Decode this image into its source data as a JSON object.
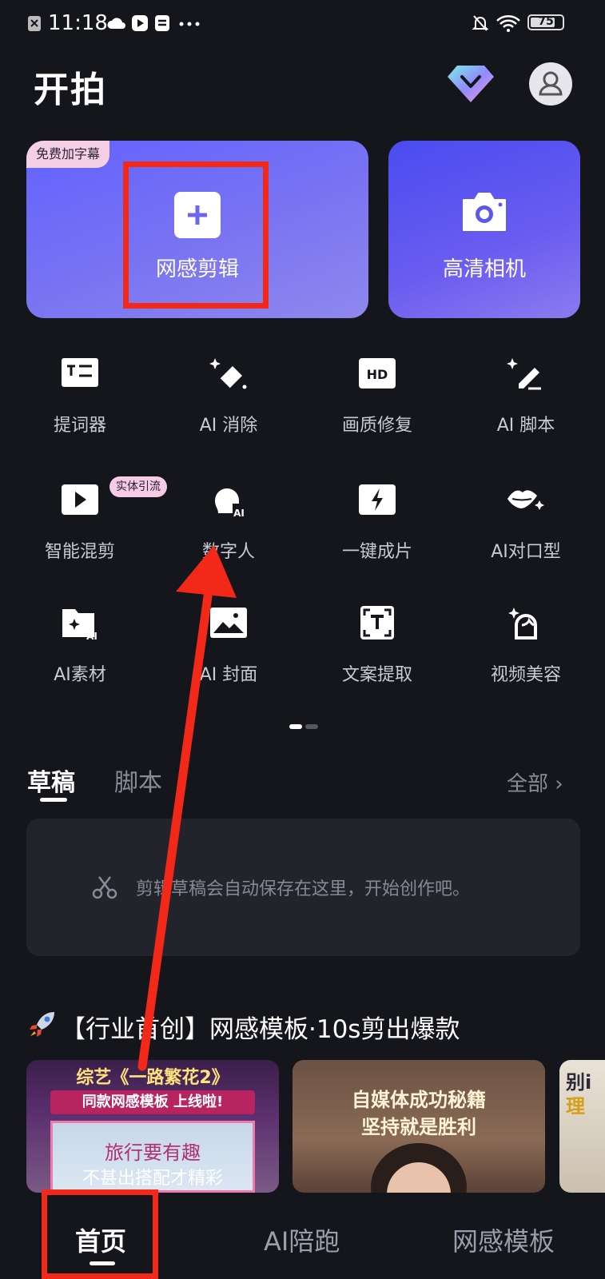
{
  "status_bar": {
    "time": "11:18",
    "battery": "75",
    "icons": [
      "sim-icon",
      "cloud-icon",
      "play-box-icon",
      "list-icon",
      "more-icon",
      "mute-bell-icon",
      "wifi-icon",
      "battery-icon"
    ]
  },
  "header": {
    "title": "开拍",
    "icons": [
      "vip-diamond-icon",
      "avatar-icon"
    ]
  },
  "hero": {
    "left_card": {
      "badge": "免费加字幕",
      "label": "网感剪辑",
      "icon": "plus-icon"
    },
    "right_card": {
      "label": "高清相机",
      "icon": "camera-icon"
    }
  },
  "tools": [
    {
      "label": "提词器",
      "icon": "teleprompter-icon"
    },
    {
      "label": "AI 消除",
      "icon": "ai-eraser-icon"
    },
    {
      "label": "画质修复",
      "icon": "hd-icon"
    },
    {
      "label": "AI 脚本",
      "icon": "ai-pen-icon"
    },
    {
      "label": "智能混剪",
      "icon": "play-square-icon",
      "badge": "实体引流"
    },
    {
      "label": "数字人",
      "icon": "digital-human-icon"
    },
    {
      "label": "一键成片",
      "icon": "lightning-icon"
    },
    {
      "label": "AI对口型",
      "icon": "lips-icon"
    },
    {
      "label": "AI素材",
      "icon": "ai-folder-icon"
    },
    {
      "label": "AI 封面",
      "icon": "image-icon"
    },
    {
      "label": "文案提取",
      "icon": "text-extract-icon"
    },
    {
      "label": "视频美容",
      "icon": "beauty-icon"
    }
  ],
  "drafts": {
    "tabs": [
      "草稿",
      "脚本"
    ],
    "active_tab": "草稿",
    "all_link": "全部 ›",
    "empty_text": "剪辑草稿会自动保存在这里，开始创作吧。"
  },
  "promo": {
    "title": "【行业首创】网感模板·10s剪出爆款",
    "templates": [
      {
        "line1": "综艺《一路繁花2》",
        "line2": "同款网感模板 上线啦!",
        "line3": "旅行要有趣",
        "line4": "不甚出搭配才精彩"
      },
      {
        "line1": "自媒体成功秘籍",
        "line2": "坚持就是胜利"
      },
      {
        "line1": "别i",
        "line2": "理"
      }
    ]
  },
  "bottom_nav": {
    "items": [
      "首页",
      "AI陪跑",
      "网感模板"
    ],
    "active": "首页"
  },
  "colors": {
    "background": "#15161b",
    "accent": "#6262ff",
    "annotation": "#f22818"
  }
}
